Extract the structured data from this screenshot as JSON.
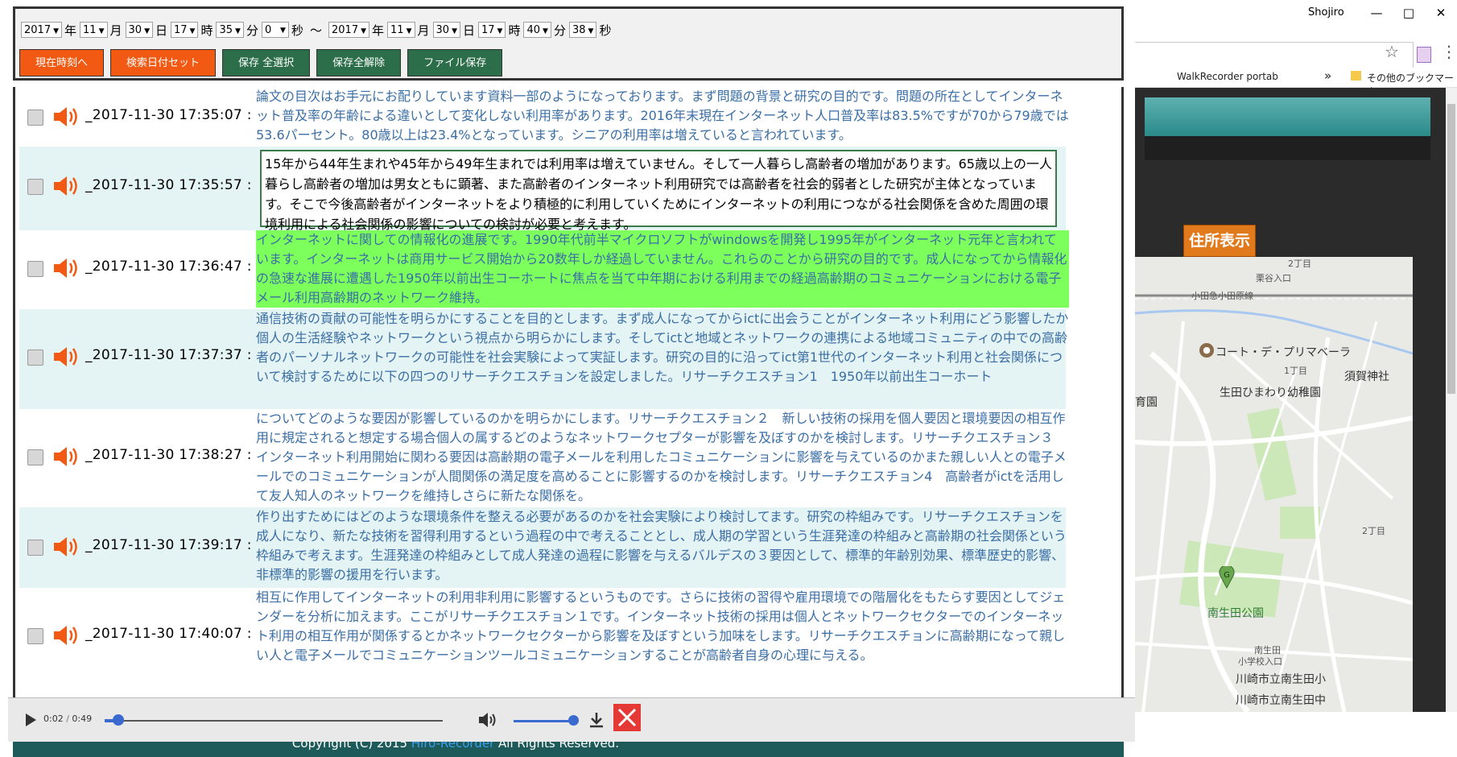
{
  "background_window": {
    "user_name": "Shojiro",
    "bookmarks": [
      "WalkRecorder portab",
      "その他のブックマーク"
    ],
    "address_button": "住所表示",
    "map_labels": [
      "2丁目",
      "栗谷入口",
      "小田急小田原線",
      "コート・デ・プリマベーラ",
      "1丁目",
      "須賀神社",
      "生田ひまわり幼稚園",
      "育園",
      "南生田公園",
      "2丁目",
      "南生田",
      "小学校入口",
      "川崎市立南生田小",
      "川崎市立南生田中"
    ],
    "map_pin_label": "G"
  },
  "controls": {
    "start": {
      "year": "2017",
      "month": "11",
      "day": "30",
      "hour": "17",
      "minute": "35",
      "second": "0"
    },
    "end": {
      "year": "2017",
      "month": "11",
      "day": "30",
      "hour": "17",
      "minute": "40",
      "second": "38"
    },
    "units": {
      "year": "年",
      "month": "月",
      "day": "日",
      "hour": "時",
      "minute": "分",
      "second": "秒",
      "range": "〜"
    },
    "buttons": {
      "now": "現在時刻へ",
      "search_date": "検索日付セット",
      "select_all": "保存 全選択",
      "clear_all": "保存全解除",
      "save_file": "ファイル保存"
    }
  },
  "records": [
    {
      "timestamp": "_2017-11-30 17:35:07 :",
      "text": "論文の目次はお手元にお配りしています資料一部のようになっております。まず問題の背景と研究の目的です。問題の所在としてインターネット普及率の年齢による違いとして変化しない利用率があります。2016年末現在インターネット人口普及率は83.5%ですが70から79歳では53.6パーセント。80歳以上は23.4%となっています。シニアの利用率は増えていると言われています。"
    },
    {
      "timestamp": "_2017-11-30 17:35:57 :",
      "text": "15年から44年生まれや45年から49年生まれでは利用率は増えていません。そして一人暮らし高齢者の増加があります。65歳以上の一人暮らし高齢者の増加は男女ともに顕著、また高齢者のインターネット利用研究では高齢者を社会的弱者とした研究が主体となっています。そこで今後高齢者がインターネットをより積極的に利用していくためにインターネットの利用につながる社会関係を含めた周囲の環境利用による社会関係の影響についての検討が必要と考えます。"
    },
    {
      "timestamp": "_2017-11-30 17:36:47 :",
      "text": "インターネットに関しての情報化の進展です。1990年代前半マイクロソフトがwindowsを開発し1995年がインターネット元年と言われています。インターネットは商用サービス開始から20数年しか経過していません。これらのことから研究の目的です。成人になってから情報化の急速な進展に遭遇した1950年以前出生コーホートに焦点を当て中年期における利用までの経過高齢期のコミュニケーションにおける電子メール利用高齢期のネットワーク維持。"
    },
    {
      "timestamp": "_2017-11-30 17:37:37 :",
      "text": "通信技術の貢献の可能性を明らかにすることを目的とします。まず成人になってからictに出会うことがインターネット利用にどう影響したか個人の生活経験やネットワークという視点から明らかにします。そしてictと地域とネットワークの連携による地域コミュニティの中での高齢者のパーソナルネットワークの可能性を社会実験によって実証します。研究の目的に沿ってict第1世代のインターネット利用と社会関係について検討するために以下の四つのリサーチクエスチョンを設定しました。リサーチクエスチョン1　1950年以前出生コーホート"
    },
    {
      "timestamp": "_2017-11-30 17:38:27 :",
      "text": "についてどのような要因が影響しているのかを明らかにします。リサーチクエスチョン２　新しい技術の採用を個人要因と環境要因の相互作用に規定されると想定する場合個人の属するどのようなネットワークセプターが影響を及ぼすのかを検討します。リサーチクエスチョン３　インターネット利用開始に関わる要因は高齢期の電子メールを利用したコミュニケーションに影響を与えているのかまた親しい人との電子メールでのコミュニケーションが人間関係の満足度を高めることに影響するのかを検討します。リサーチクエスチョン4　高齢者がictを活用して友人知人のネットワークを維持しさらに新たな関係を。"
    },
    {
      "timestamp": "_2017-11-30 17:39:17 :",
      "text": "作り出すためにはどのような環境条件を整える必要があるのかを社会実験により検討してます。研究の枠組みです。リサーチクエスチョンを成人になり、新たな技術を習得利用するという過程の中で考えることとし、成人期の学習という生涯発達の枠組みと高齢期の社会関係という枠組みで考えます。生涯発達の枠組みとして成人発達の過程に影響を与えるバルデスの３要因として、標準的年齢別効果、標準歴史的影響、非標準的影響の援用を行います。"
    },
    {
      "timestamp": "_2017-11-30 17:40:07 :",
      "text": "相互に作用してインターネットの利用非利用に影響するというものです。さらに技術の習得や雇用環境での階層化をもたらす要因としてジェンダーを分析に加えます。ここがリサーチクエスチョン１です。インターネット技術の採用は個人とネットワークセクターでのインターネット利用の相互作用が関係するとかネットワークセクターから影響を及ぼすという加味をします。リサーチクエスチョンに高齢期になって親しい人と電子メールでコミュニケーションツールコミュニケーションすることが高齢者自身の心理に与える。"
    }
  ],
  "player": {
    "current": "0:02",
    "duration": "0:49",
    "separator": " / ",
    "progress": 0.04,
    "volume": 1.0
  },
  "footer": {
    "prefix": "Copyright (C) 2015 ",
    "link": "Hiro-Recorder",
    "suffix": " All Rights Reserved."
  },
  "colors": {
    "accent_orange": "#f25a13",
    "accent_green": "#2c6e4a",
    "text_blue": "#3a6ea5",
    "highlight": "#7dff5c",
    "row_alt": "#e4f3f3",
    "footer_bg": "#1f5a5a"
  }
}
